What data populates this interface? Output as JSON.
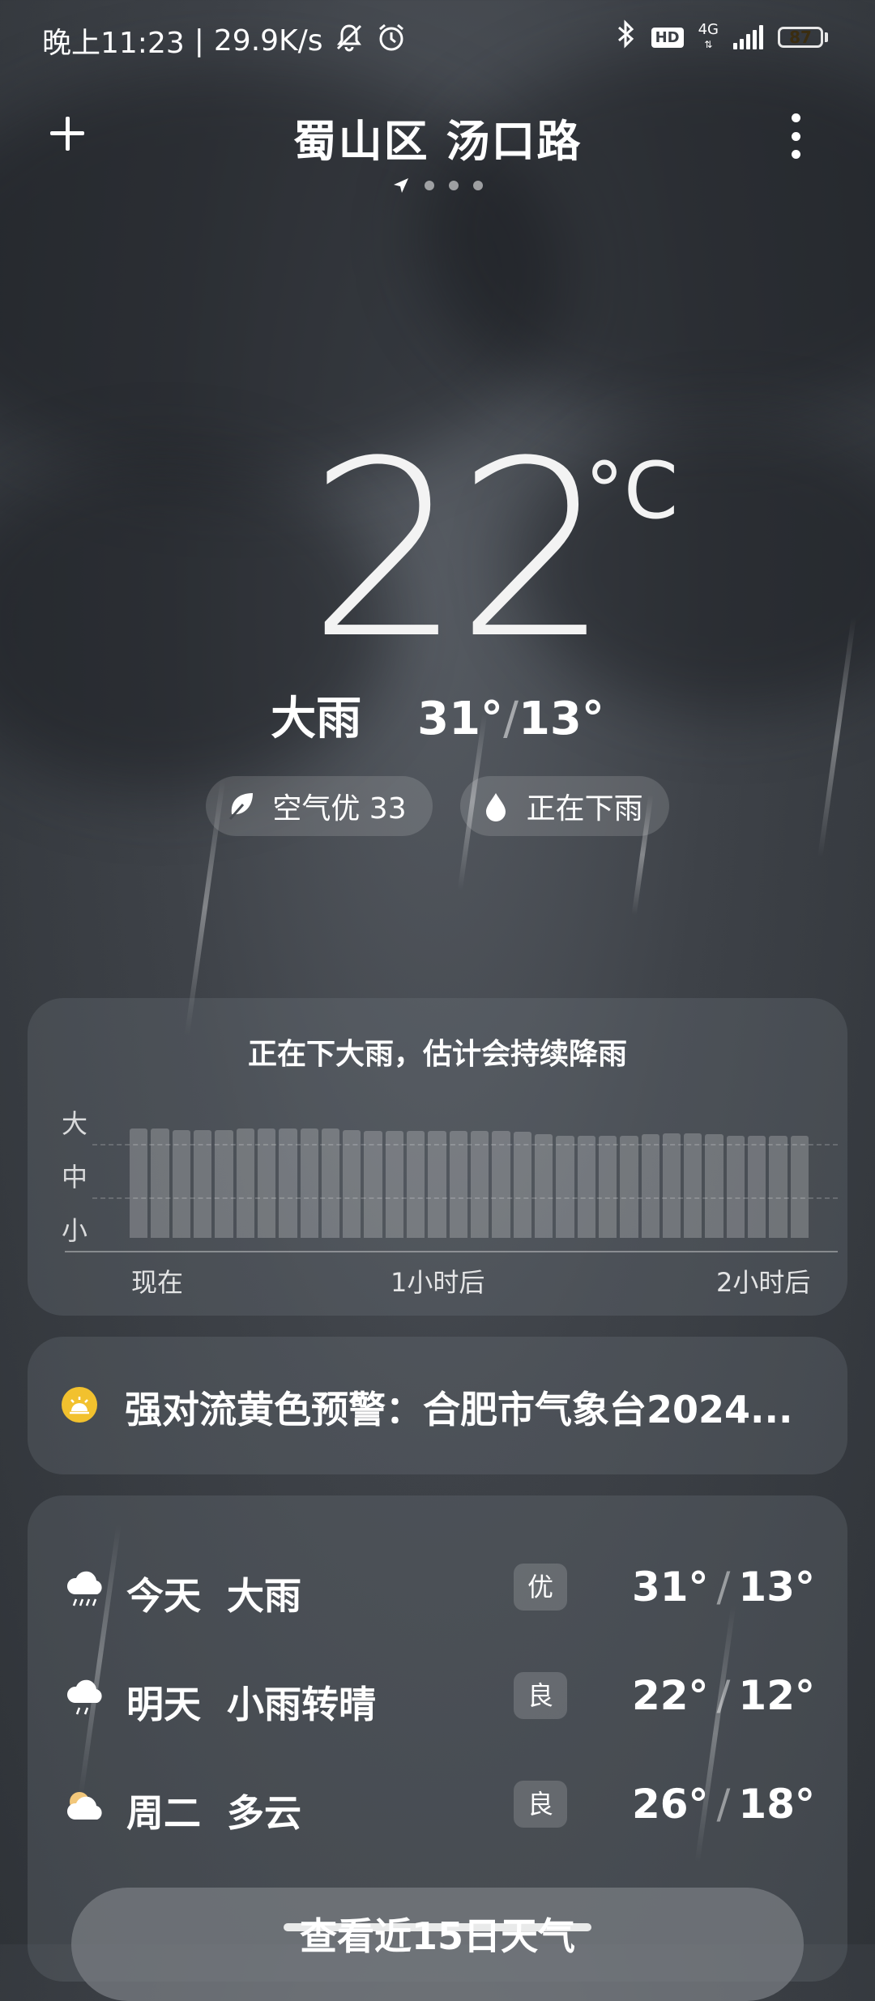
{
  "status_bar": {
    "time": "晚上11:23",
    "speed": "29.9K/s",
    "network": "4G",
    "battery": "87",
    "icons": [
      "mute-icon",
      "alarm-icon",
      "bluetooth-icon",
      "hd-icon",
      "signal-icon",
      "battery-icon"
    ]
  },
  "header": {
    "location": "蜀山区 汤口路",
    "add_icon": "plus-icon",
    "menu_icon": "more-vertical-icon",
    "page_count": 4
  },
  "current": {
    "temperature": "22",
    "unit": "°C",
    "condition": "大雨",
    "high": "31°",
    "separator": "/",
    "low": "13°",
    "chips": [
      {
        "icon": "leaf-icon",
        "label": "空气优 33"
      },
      {
        "icon": "drop-icon",
        "label": "正在下雨"
      }
    ]
  },
  "precipitation": {
    "title": "正在下大雨，估计会持续降雨",
    "levels": [
      "大",
      "中",
      "小"
    ],
    "x_labels": [
      "现在",
      "1小时后",
      "2小时后"
    ],
    "intensity": [
      0.99,
      0.99,
      0.98,
      0.98,
      0.98,
      0.99,
      0.99,
      0.99,
      0.99,
      0.99,
      0.98,
      0.97,
      0.97,
      0.97,
      0.97,
      0.97,
      0.97,
      0.97,
      0.96,
      0.94,
      0.93,
      0.93,
      0.93,
      0.93,
      0.94,
      0.95,
      0.95,
      0.94,
      0.93,
      0.93,
      0.93,
      0.93
    ]
  },
  "warning": {
    "icon": "warning-sun-icon",
    "text": "强对流黄色预警：合肥市气象台2024...",
    "color": "#f2c12e"
  },
  "forecast": [
    {
      "icon": "heavy-rain-icon",
      "day": "今天",
      "condition": "大雨",
      "aqi": "优",
      "high": "31°",
      "low": "13°"
    },
    {
      "icon": "light-rain-icon",
      "day": "明天",
      "condition": "小雨转晴",
      "aqi": "良",
      "high": "22°",
      "low": "12°"
    },
    {
      "icon": "partly-cloudy-icon",
      "day": "周二",
      "condition": "多云",
      "aqi": "良",
      "high": "26°",
      "low": "18°"
    }
  ],
  "forecast_separator": "/",
  "more_button": "查看近15日天气"
}
